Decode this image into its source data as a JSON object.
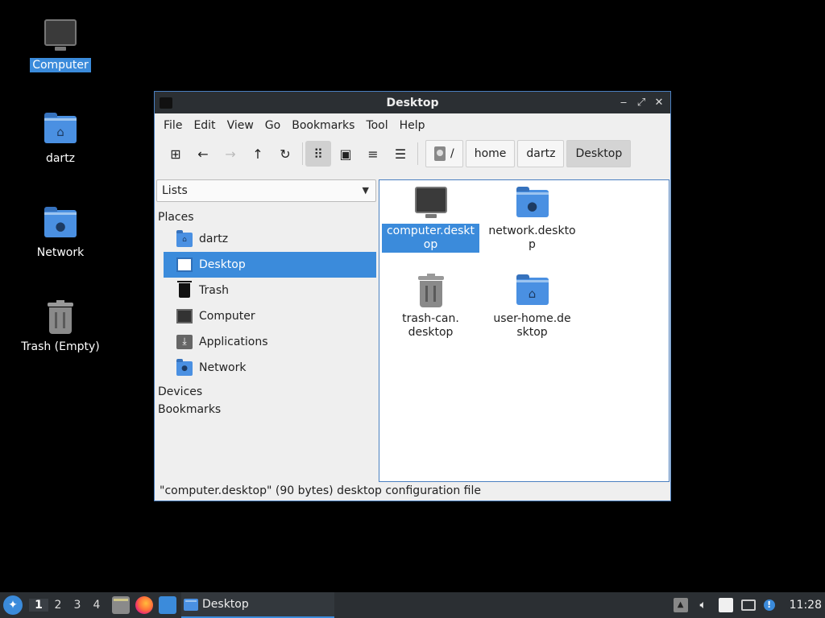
{
  "desktop": {
    "icons": [
      {
        "label": "Computer",
        "icon": "computer-icon",
        "selected": true
      },
      {
        "label": "dartz",
        "icon": "home-folder-icon"
      },
      {
        "label": "Network",
        "icon": "network-folder-icon"
      },
      {
        "label": "Trash (Empty)",
        "icon": "trash-icon"
      }
    ]
  },
  "window": {
    "title": "Desktop",
    "controls": {
      "minimize": "‒",
      "maximize": "⤢",
      "close": "✕"
    },
    "menu": [
      "File",
      "Edit",
      "View",
      "Go",
      "Bookmarks",
      "Tool",
      "Help"
    ],
    "toolbar": {
      "new_tab": "⊞",
      "back": "←",
      "forward": "→",
      "up": "↑",
      "reload": "↻",
      "view_icons": "⠿",
      "view_thumbnails": "▣",
      "view_compact": "≡",
      "view_list": "☰"
    },
    "breadcrumb": {
      "root": "/",
      "parts": [
        "home",
        "dartz",
        "Desktop"
      ]
    },
    "sidepane": {
      "mode": "Lists",
      "places_header": "Places",
      "places": [
        {
          "label": "dartz",
          "icon": "home-folder-icon"
        },
        {
          "label": "Desktop",
          "icon": "desktop-icon",
          "selected": true
        },
        {
          "label": "Trash",
          "icon": "trash-icon"
        },
        {
          "label": "Computer",
          "icon": "computer-icon"
        },
        {
          "label": "Applications",
          "icon": "applications-icon"
        },
        {
          "label": "Network",
          "icon": "network-folder-icon"
        }
      ],
      "devices_header": "Devices",
      "bookmarks_header": "Bookmarks"
    },
    "files": [
      {
        "name": "computer.desktop",
        "icon": "computer-icon",
        "selected": true
      },
      {
        "name": "network.desktop",
        "icon": "network-folder-icon"
      },
      {
        "name": "trash-can.desktop",
        "icon": "trash-icon"
      },
      {
        "name": "user-home.desktop",
        "icon": "home-folder-icon"
      }
    ],
    "status": "\"computer.desktop\" (90 bytes) desktop configuration file"
  },
  "taskbar": {
    "workspaces": [
      "1",
      "2",
      "3",
      "4"
    ],
    "active_workspace": "1",
    "task_label": "Desktop",
    "clock": "11:28",
    "update_badge": "!"
  },
  "colors": {
    "accent": "#3b8bdb",
    "folder": "#4a90e2",
    "panel": "#2b2f33"
  }
}
